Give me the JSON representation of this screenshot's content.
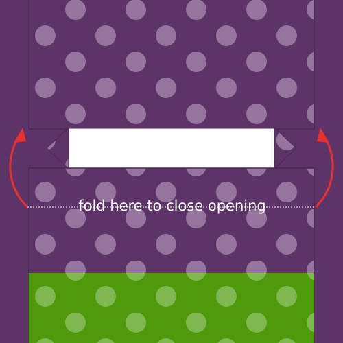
{
  "instruction": {
    "fold_label": "fold here to close opening"
  },
  "colors": {
    "background": "#5d3468",
    "fabric_purple": "#5d3468",
    "fabric_edge": "#4a2753",
    "polka_dot": "#a889b0",
    "fabric_green": "#4e9a0a",
    "arrow": "#e8312f",
    "fold_line": "#ffffff",
    "opening": "#ffffff"
  },
  "icons": {
    "left_arrow": "curved-arrow-up-icon",
    "right_arrow": "curved-arrow-up-icon"
  }
}
